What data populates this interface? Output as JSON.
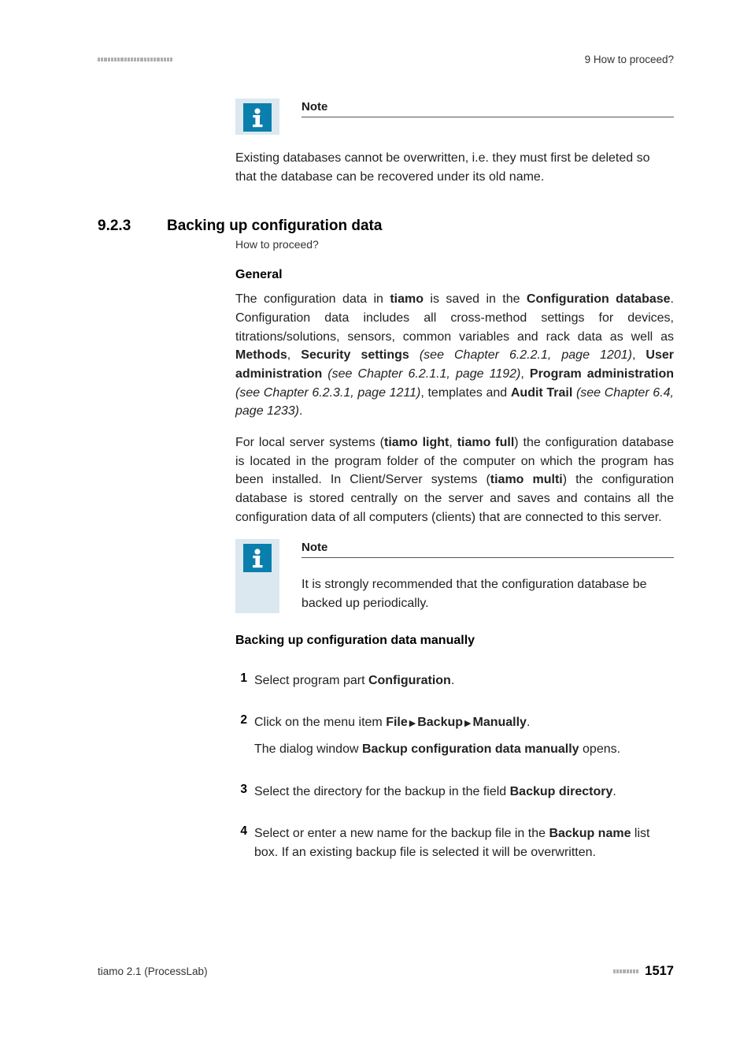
{
  "header": {
    "right_text": "9 How to proceed?"
  },
  "note1": {
    "title": "Note",
    "body": "Existing databases cannot be overwritten, i.e. they must first be deleted so that the database can be recovered under its old name."
  },
  "section": {
    "number": "9.2.3",
    "title": "Backing up configuration data",
    "subtitle": "How to proceed?"
  },
  "general": {
    "heading": "General",
    "p1_a": "The configuration data in ",
    "p1_b": "tiamo",
    "p1_c": " is saved in the ",
    "p1_d": "Configuration database",
    "p1_e": ". Configuration data includes all cross-method settings for devices, titrations/solutions, sensors, common variables and rack data as well as ",
    "p1_f": "Methods",
    "p1_g": ", ",
    "p1_h": "Security settings",
    "p1_i": " (see Chapter 6.2.2.1, page 1201)",
    "p1_j": ", ",
    "p1_k": "User administration",
    "p1_l": " (see Chapter 6.2.1.1, page 1192)",
    "p1_m": ", ",
    "p1_n": "Program administration",
    "p1_o": " (see Chapter 6.2.3.1, page 1211)",
    "p1_p": ", templates and ",
    "p1_q": "Audit Trail",
    "p1_r": " (see Chapter 6.4, page 1233)",
    "p1_s": ".",
    "p2_a": "For local server systems (",
    "p2_b": "tiamo light",
    "p2_c": ", ",
    "p2_d": "tiamo full",
    "p2_e": ") the configuration database is located in the program folder of the computer on which the program has been installed. In Client/Server systems (",
    "p2_f": "tiamo multi",
    "p2_g": ") the configuration database is stored centrally on the server and saves and contains all the configuration data of all computers (clients) that are connected to this server."
  },
  "note2": {
    "title": "Note",
    "body": "It is strongly recommended that the configuration database be backed up periodically."
  },
  "manual": {
    "heading": "Backing up configuration data manually"
  },
  "steps": {
    "s1_num": "1",
    "s1_a": "Select program part ",
    "s1_b": "Configuration",
    "s1_c": ".",
    "s2_num": "2",
    "s2_a": "Click on the menu item ",
    "s2_b": "File",
    "s2_c": "Backup",
    "s2_d": "Manually",
    "s2_e": ".",
    "s2_p2_a": "The dialog window ",
    "s2_p2_b": "Backup configuration data manually",
    "s2_p2_c": " opens.",
    "s3_num": "3",
    "s3_a": "Select the directory for the backup in the field ",
    "s3_b": "Backup directory",
    "s3_c": ".",
    "s4_num": "4",
    "s4_a": "Select or enter a new name for the backup file in the ",
    "s4_b": "Backup name",
    "s4_c": " list box. If an existing backup file is selected it will be overwritten."
  },
  "footer": {
    "left": "tiamo 2.1 (ProcessLab)",
    "page": "1517"
  }
}
